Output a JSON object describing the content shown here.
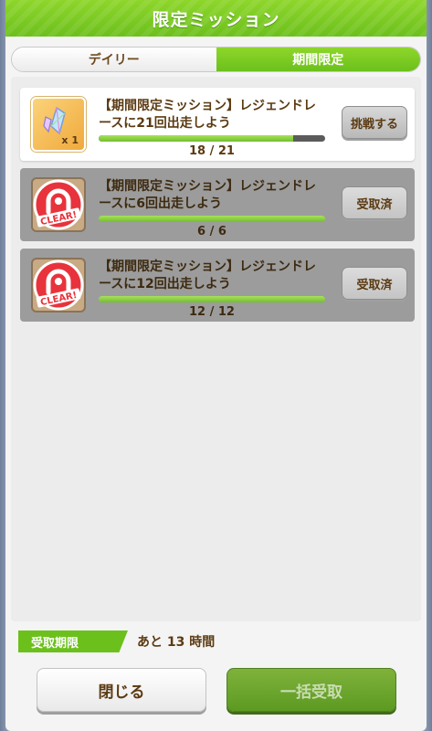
{
  "header": {
    "title": "限定ミッション"
  },
  "tabs": [
    {
      "label": "デイリー",
      "active": false
    },
    {
      "label": "期間限定",
      "active": true
    }
  ],
  "missions": [
    {
      "text": "【期間限定ミッション】レジェンドレースに21回出走しよう",
      "progress": "18 / 21",
      "progress_fraction": 0.857,
      "button": "挑戦する",
      "reward_qty": "x 1",
      "icon": "rainbow-gem-icon",
      "state": "active"
    },
    {
      "text": "【期間限定ミッション】レジェンドレースに6回出走しよう",
      "progress": "6 / 6",
      "progress_fraction": 1.0,
      "button": "受取済",
      "badge": "CLEAR!",
      "icon": "horseshoe-clear-icon",
      "state": "claimed"
    },
    {
      "text": "【期間限定ミッション】レジェンドレースに12回出走しよう",
      "progress": "12 / 12",
      "progress_fraction": 1.0,
      "button": "受取済",
      "badge": "CLEAR!",
      "icon": "horseshoe-clear-icon",
      "state": "claimed"
    }
  ],
  "deadline": {
    "label": "受取期限",
    "value": "あと 13 時間"
  },
  "footer": {
    "close_label": "閉じる",
    "claim_all_label": "一括受取"
  },
  "colors": {
    "accent_green": "#6cc01c",
    "text_brown": "#5b3a12",
    "claimed_gray": "#9c9c9c"
  }
}
